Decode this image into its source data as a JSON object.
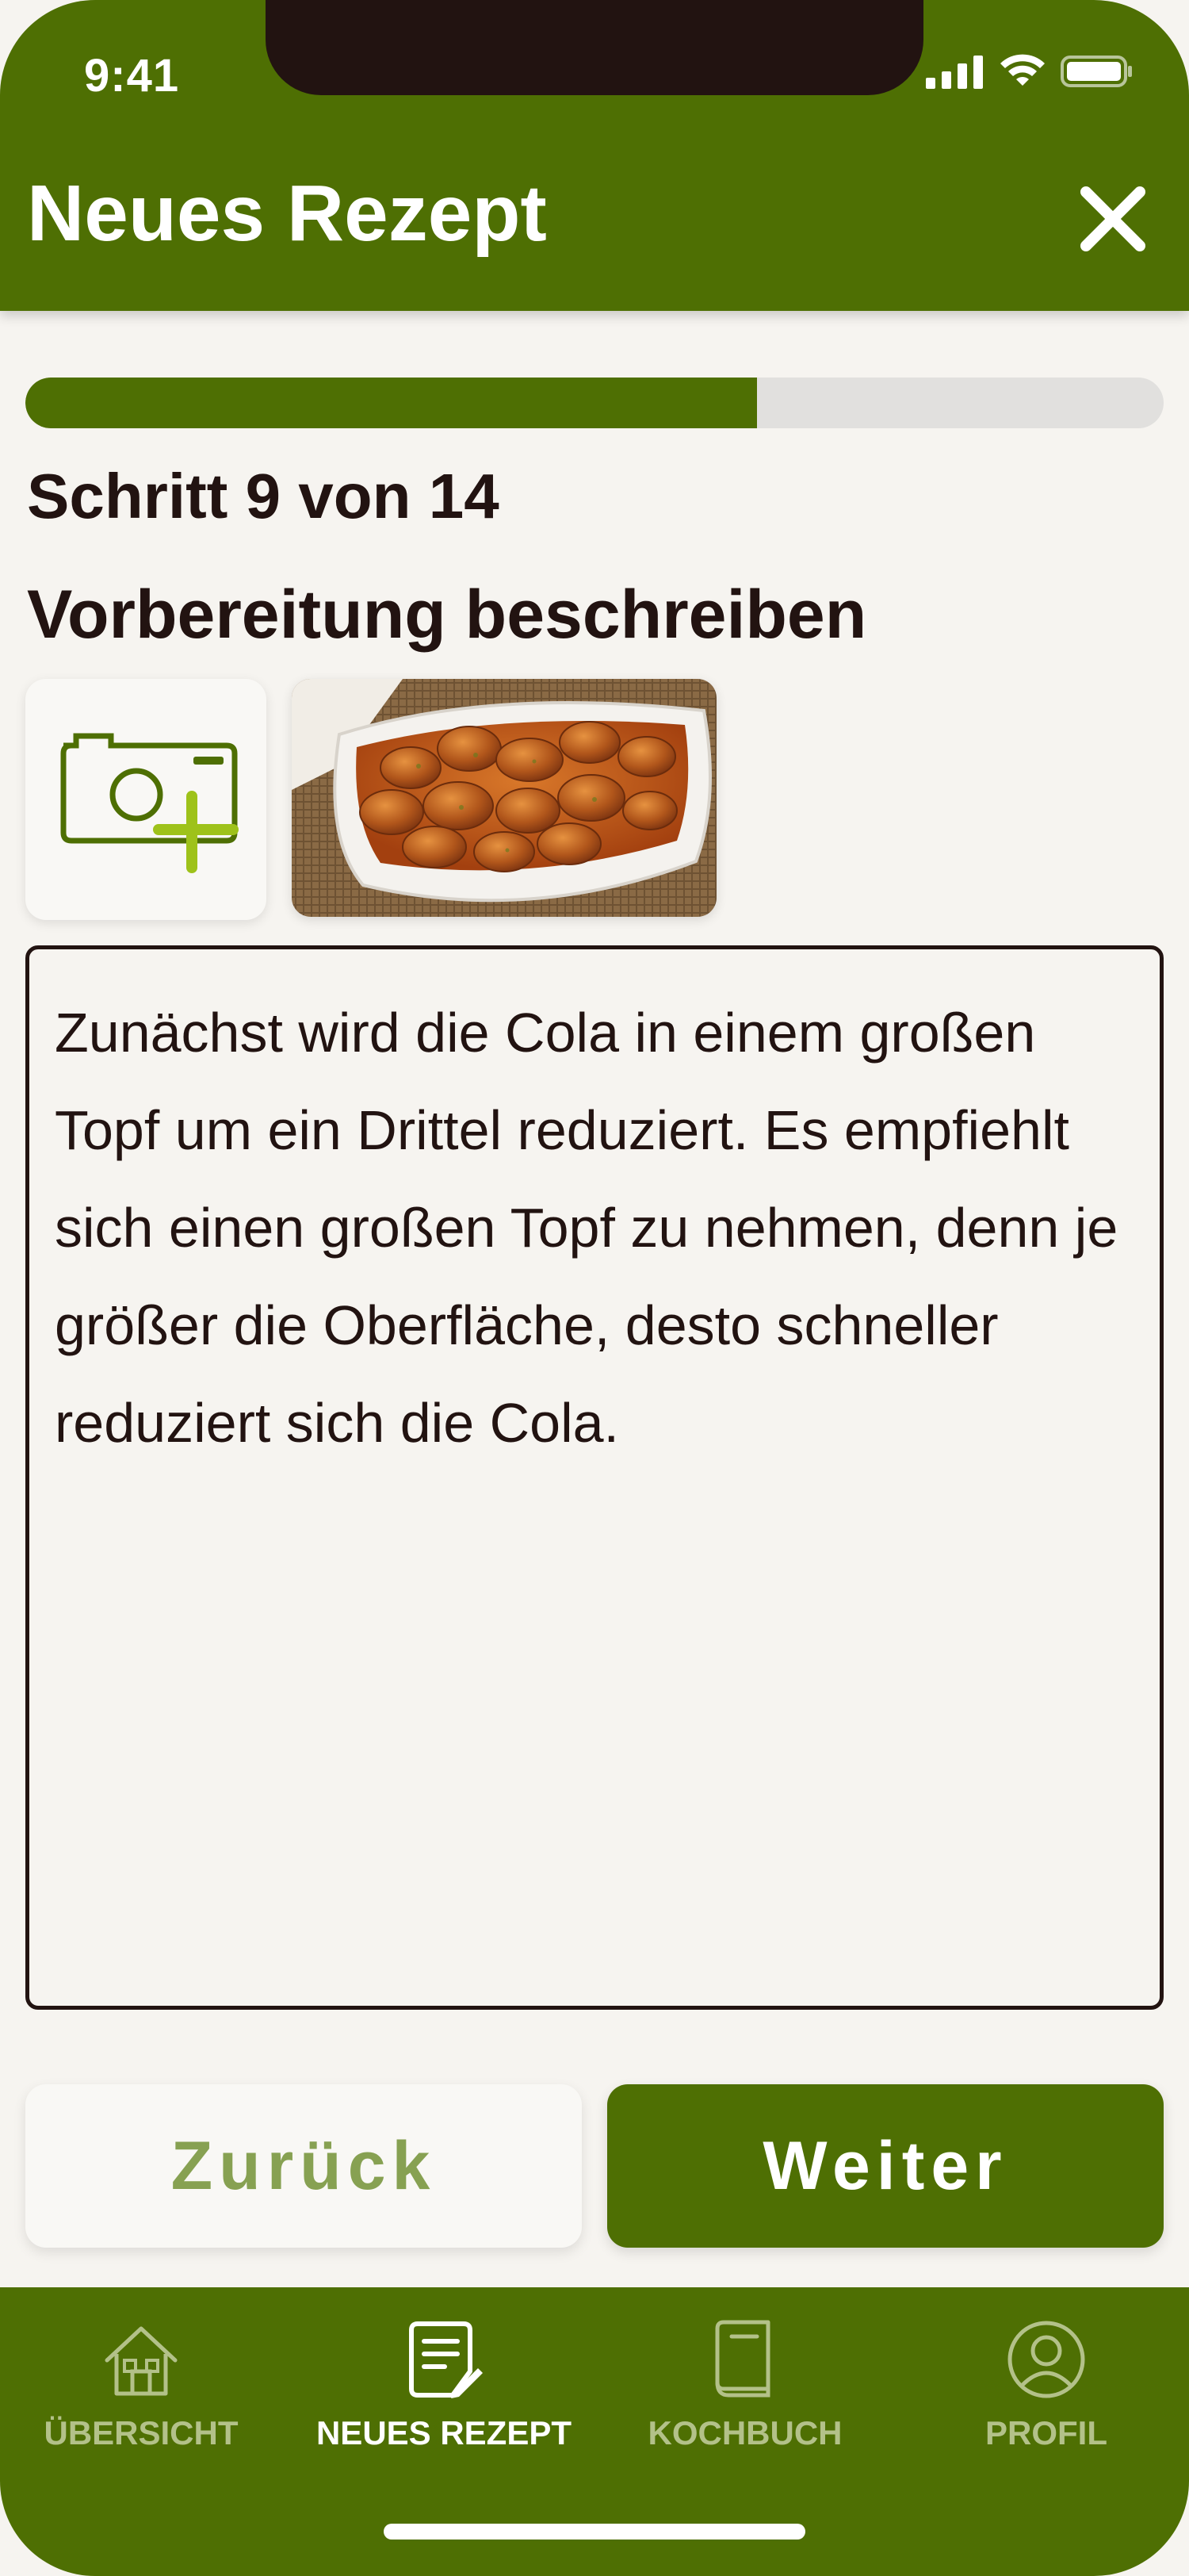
{
  "status_bar": {
    "time": "9:41"
  },
  "header": {
    "title": "Neues Rezept",
    "close_icon": "close-icon"
  },
  "progress": {
    "value": 0.643
  },
  "step_label": "Schritt 9 von 14",
  "subtitle": "Vorbereitung beschreiben",
  "media": {
    "add_icon": "camera-plus-icon",
    "photo_alt": "Currywurst in einer weißen Schale"
  },
  "description": "Zunächst wird die Cola in einem großen Topf um ein Drittel reduziert. Es empfiehlt sich einen großen Topf zu nehmen, denn je größer die Oberfläche, desto schneller reduziert sich die Cola.",
  "buttons": {
    "back": "Zurück",
    "next": "Weiter"
  },
  "tabbar": {
    "items": [
      {
        "label": "ÜBERSICHT",
        "icon": "home-icon",
        "active": false
      },
      {
        "label": "NEUES REZEPT",
        "icon": "recipe-edit-icon",
        "active": true
      },
      {
        "label": "KOCHBUCH",
        "icon": "book-icon",
        "active": false
      },
      {
        "label": "PROFIL",
        "icon": "profile-icon",
        "active": false
      }
    ]
  },
  "colors": {
    "brand": "#4e6f03",
    "accent": "#87a152",
    "background": "#f6f4f0",
    "text": "#221311",
    "inactive_tab": "#b3c189"
  }
}
